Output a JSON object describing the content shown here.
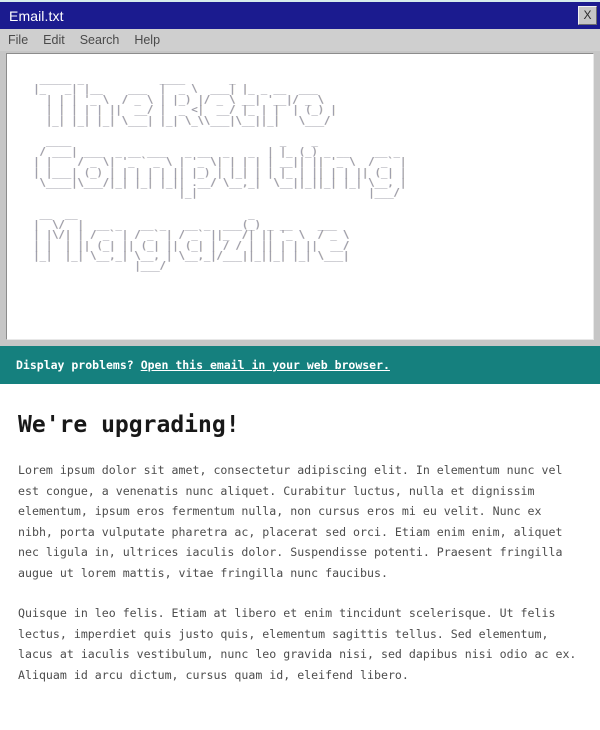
{
  "window": {
    "title": "Email.txt",
    "close_label": "X",
    "menu": [
      {
        "label": "File"
      },
      {
        "label": "Edit"
      },
      {
        "label": "Search"
      },
      {
        "label": "Help"
      }
    ]
  },
  "banner_art": {
    "alt_text": "The Retro Computing Magazine",
    "ascii": "  _____ _            ____       _              \n |_   _| |__    ___  |  _ \\  ___| |_ _ __  ___  \n   | | | '_ \\  / _ \\ | |_) |/ _ \\ __| '__|/ _ \\ \n   | | | | | ||  __/ |  _ <|  __/ |_ | |  | (_) |\n   |_| |_| |_| \\___| |_| \\_\\\\___|\\__||_|   \\___/ \n\n   ____                                 _    _               \n  / ___| ___  _ __ ___   _ __  _   _  | |_ (_) _ __    __ _ \n | |    / _ \\| '_ ` _ \\ | '_ \\| | | | | __|| || '_ \\  / _` |\n | |___| (_) | | | | | || |_) | |_| | | |_ | || | | || (_| |\n  \\____|\\___/|_| |_| |_|| .__/ \\__,_|  \\__||_||_| |_| \\__, |\n                        |_|                           |___/ \n\n  __  __                           _                     \n |  \\/  |  __ _   __ _   __ _  ___(_) _ __    ___        \n | |\\/| | / _` | / _` | / _` ||_  /| || '_ \\  / _ \\       \n | |  | || (_| || (_| || (_| | / / | || | | ||  __/       \n |_|  |_| \\__,_| \\__, | \\__,_|/___||_||_| |_| \\___|       \n                 |___/                                    "
  },
  "notice": {
    "prompt": "Display problems?",
    "link_text": "Open this email in your web browser."
  },
  "email": {
    "heading": "We're upgrading!",
    "paragraphs": [
      "Lorem ipsum dolor sit amet, consectetur adipiscing elit. In elementum nunc vel est congue, a venenatis nunc aliquet. Curabitur luctus, nulla et dignissim elementum, ipsum eros fermentum nulla, non cursus eros mi eu velit. Nunc ex nibh, porta vulputate pharetra ac, placerat sed orci. Etiam enim enim, aliquet nec ligula in, ultrices iaculis dolor. Suspendisse potenti. Praesent fringilla augue ut lorem mattis, vitae fringilla nunc faucibus.",
      "Quisque in leo felis. Etiam at libero et enim tincidunt scelerisque. Ut felis lectus, imperdiet quis justo quis, elementum sagittis tellus. Sed elementum, lacus at iaculis vestibulum, nunc leo gravida nisi, sed dapibus nisi odio ac ex. Aliquam id arcu dictum, cursus quam id, eleifend libero."
    ]
  },
  "colors": {
    "titlebar": "#1b1b8f",
    "chrome": "#c6c6c6",
    "banner_teal": "#15807e",
    "body_text": "#4d4d4d",
    "heading": "#181818"
  }
}
